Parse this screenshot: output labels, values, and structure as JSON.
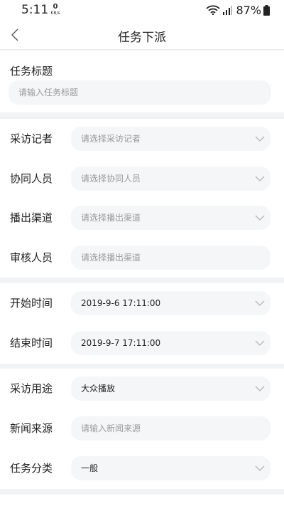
{
  "status_bar": {
    "time": "5:11",
    "net_speed_value": "0",
    "net_speed_unit": "KB/s",
    "battery": "87%",
    "icons": [
      "wifi-icon",
      "signal-icon",
      "battery-icon"
    ]
  },
  "nav": {
    "title": "任务下派",
    "back_icon": "chevron-left-icon"
  },
  "task_title": {
    "label": "任务标题",
    "placeholder": "请输入任务标题",
    "value": ""
  },
  "people": {
    "reporter": {
      "label": "采访记者",
      "placeholder": "请选择采访记者"
    },
    "collaborator": {
      "label": "协同人员",
      "placeholder": "请选择协同人员"
    },
    "channel": {
      "label": "播出渠道",
      "placeholder": "请选择播出渠道"
    },
    "reviewer": {
      "label": "审核人员",
      "placeholder": "请选择播出渠道"
    }
  },
  "time": {
    "start": {
      "label": "开始时间",
      "value": "2019-9-6 17:11:00"
    },
    "end": {
      "label": "结束时间",
      "value": "2019-9-7 17:11:00"
    }
  },
  "info": {
    "purpose": {
      "label": "采访用途",
      "value": "大众播放"
    },
    "source": {
      "label": "新闻来源",
      "placeholder": "请输入新闻来源",
      "value": ""
    },
    "category": {
      "label": "任务分类",
      "value": "一般"
    }
  },
  "colors": {
    "page_bg": "#f2f3f5",
    "field_bg": "#f5f6f8",
    "placeholder": "#9a9a9a",
    "text": "#222222",
    "chevron": "#b5b5b5"
  }
}
